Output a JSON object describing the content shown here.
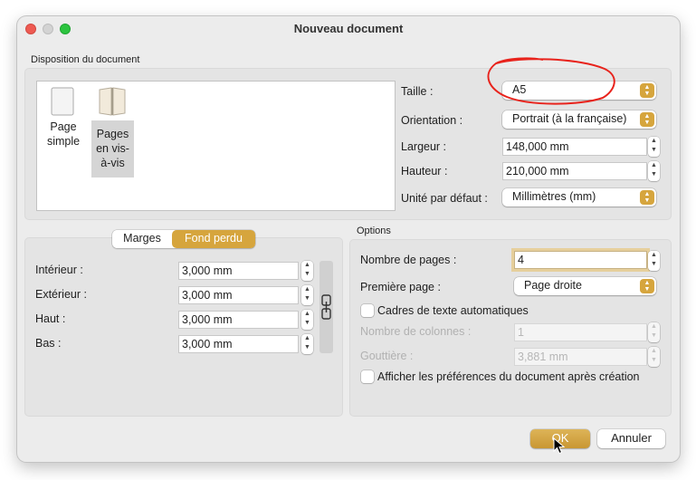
{
  "window": {
    "title": "Nouveau document"
  },
  "disposition": {
    "section_label": "Disposition du document",
    "page_simple_label": "Page\nsimple",
    "pages_vis_label": "Pages\nen vis-\nà-vis",
    "taille_label": "Taille :",
    "taille_value": "A5",
    "orientation_label": "Orientation :",
    "orientation_value": "Portrait (à la française)",
    "largeur_label": "Largeur :",
    "largeur_value": "148,000 mm",
    "hauteur_label": "Hauteur :",
    "hauteur_value": "210,000 mm",
    "unite_label": "Unité par défaut :",
    "unite_value": "Millimètres (mm)"
  },
  "margins": {
    "tab_marges": "Marges",
    "tab_fond_perdu": "Fond perdu",
    "interieur_label": "Intérieur :",
    "interieur_value": "3,000 mm",
    "exterieur_label": "Extérieur :",
    "exterieur_value": "3,000 mm",
    "haut_label": "Haut :",
    "haut_value": "3,000 mm",
    "bas_label": "Bas :",
    "bas_value": "3,000 mm"
  },
  "options": {
    "section_label": "Options",
    "nombre_pages_label": "Nombre de pages :",
    "nombre_pages_value": "4",
    "premiere_page_label": "Première page :",
    "premiere_page_value": "Page droite",
    "cadres_label": "Cadres de texte automatiques",
    "nombre_colonnes_label": "Nombre de colonnes :",
    "nombre_colonnes_value": "1",
    "gouttiere_label": "Gouttière :",
    "gouttiere_value": "3,881 mm",
    "afficher_prefs_label": "Afficher les préférences du document après création"
  },
  "buttons": {
    "ok": "OK",
    "annuler": "Annuler"
  },
  "colors": {
    "accent": "#d6a53d",
    "annotation": "#e8231c"
  }
}
